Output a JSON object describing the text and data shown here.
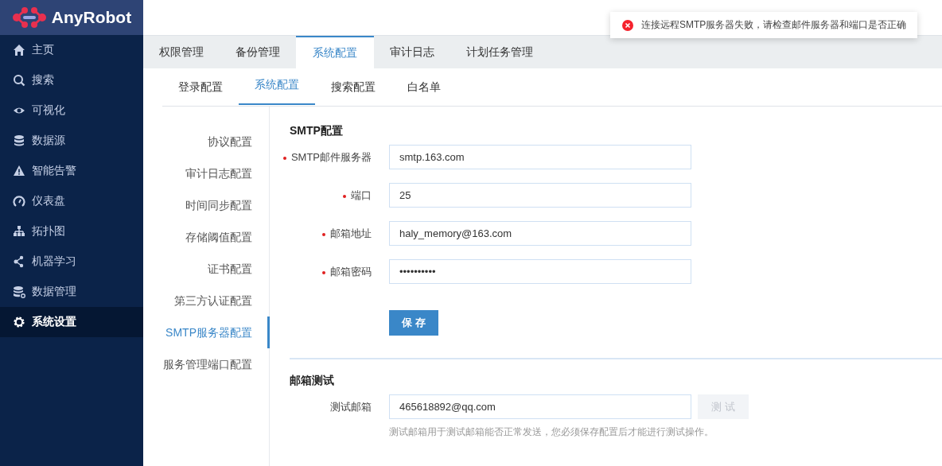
{
  "logo": {
    "text": "AnyRobot"
  },
  "sidebar": {
    "items": [
      {
        "label": "主页",
        "selected": false
      },
      {
        "label": "搜索",
        "selected": false
      },
      {
        "label": "可视化",
        "selected": false
      },
      {
        "label": "数据源",
        "selected": false
      },
      {
        "label": "智能告警",
        "selected": false
      },
      {
        "label": "仪表盘",
        "selected": false
      },
      {
        "label": "拓扑图",
        "selected": false
      },
      {
        "label": "机器学习",
        "selected": false
      },
      {
        "label": "数据管理",
        "selected": false
      },
      {
        "label": "系统设置",
        "selected": true
      }
    ]
  },
  "toast": {
    "kind": "error",
    "message": "连接远程SMTP服务器失败，请检查邮件服务器和端口是否正确"
  },
  "tabs": [
    {
      "label": "权限管理",
      "selected": false
    },
    {
      "label": "备份管理",
      "selected": false
    },
    {
      "label": "系统配置",
      "selected": true
    },
    {
      "label": "审计日志",
      "selected": false
    },
    {
      "label": "计划任务管理",
      "selected": false
    }
  ],
  "subtabs": [
    {
      "label": "登录配置",
      "selected": false
    },
    {
      "label": "系统配置",
      "selected": true
    },
    {
      "label": "搜索配置",
      "selected": false
    },
    {
      "label": "白名单",
      "selected": false
    }
  ],
  "side_nav": [
    {
      "label": "协议配置",
      "selected": false
    },
    {
      "label": "审计日志配置",
      "selected": false
    },
    {
      "label": "时间同步配置",
      "selected": false
    },
    {
      "label": "存储阈值配置",
      "selected": false
    },
    {
      "label": "证书配置",
      "selected": false
    },
    {
      "label": "第三方认证配置",
      "selected": false
    },
    {
      "label": "SMTP服务器配置",
      "selected": true
    },
    {
      "label": "服务管理端口配置",
      "selected": false
    }
  ],
  "smtp_section": {
    "title": "SMTP配置",
    "fields": [
      {
        "label": "SMTP邮件服务器",
        "required": true,
        "value": "smtp.163.com"
      },
      {
        "label": "端口",
        "required": true,
        "value": "25"
      },
      {
        "label": "邮箱地址",
        "required": true,
        "value": "haly_memory@163.com"
      },
      {
        "label": "邮箱密码",
        "required": true,
        "value": "••••••••••"
      }
    ],
    "save_button": {
      "label": "保 存",
      "disabled": false
    }
  },
  "test_section": {
    "title": "邮箱测试",
    "field": {
      "label": "测试邮箱",
      "required": false,
      "value": "465618892@qq.com"
    },
    "test_button": {
      "label": "测 试",
      "disabled": true
    },
    "hint": "测试邮箱用于测试邮箱能否正常发送，您必须保存配置后才能进行测试操作。"
  }
}
